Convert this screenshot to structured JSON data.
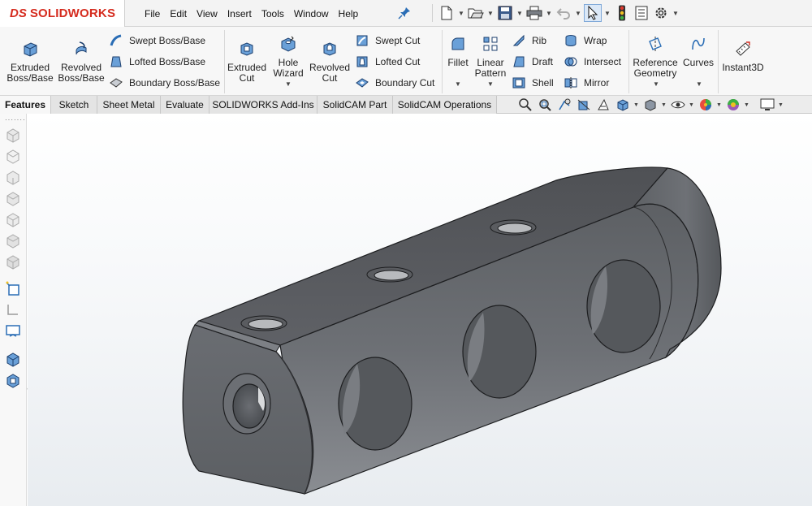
{
  "app": {
    "name": "SOLIDWORKS",
    "logo_mark": "DS"
  },
  "menu": [
    "File",
    "Edit",
    "View",
    "Insert",
    "Tools",
    "Window",
    "Help"
  ],
  "ribbon": {
    "extruded_boss": "Extruded Boss/Base",
    "revolved_boss": "Revolved Boss/Base",
    "swept_boss": "Swept Boss/Base",
    "lofted_boss": "Lofted Boss/Base",
    "boundary_boss": "Boundary Boss/Base",
    "extruded_cut": "Extruded Cut",
    "hole_wizard": "Hole Wizard",
    "revolved_cut": "Revolved Cut",
    "swept_cut": "Swept Cut",
    "lofted_cut": "Lofted Cut",
    "boundary_cut": "Boundary Cut",
    "fillet": "Fillet",
    "linear_pattern": "Linear Pattern",
    "rib": "Rib",
    "draft": "Draft",
    "shell": "Shell",
    "wrap": "Wrap",
    "intersect": "Intersect",
    "mirror": "Mirror",
    "reference_geometry": "Reference Geometry",
    "curves": "Curves",
    "instant3d": "Instant3D"
  },
  "tabs": [
    "Features",
    "Sketch",
    "Sheet Metal",
    "Evaluate",
    "SOLIDWORKS Add-Ins",
    "SolidCAM Part",
    "SolidCAM Operations"
  ],
  "active_tab": "Features",
  "colors": {
    "accent": "#d52b1e",
    "icon_blue": "#2a6db5",
    "model_gray": "#5a5c60"
  },
  "view_icons": [
    "zoom-to-fit-icon",
    "zoom-area-icon",
    "previous-view-icon",
    "section-view-icon",
    "dynamic-annotation-icon",
    "view-orientation-icon",
    "display-style-icon",
    "hide-show-icon",
    "edit-appearance-icon",
    "apply-scene-icon",
    "view-settings-icon"
  ]
}
